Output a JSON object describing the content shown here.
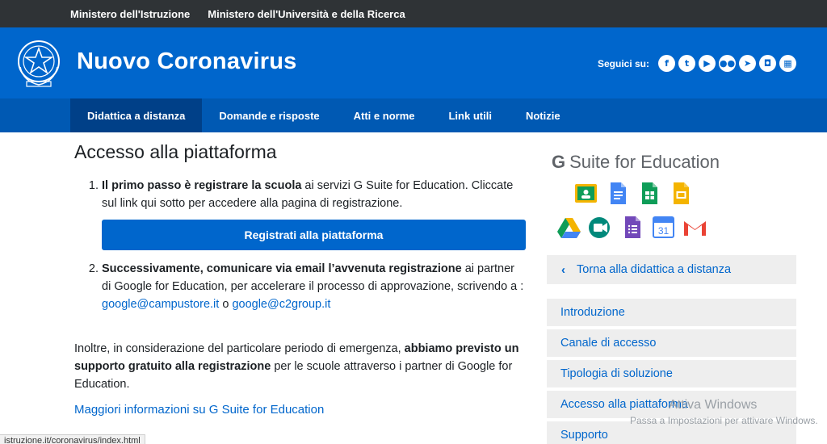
{
  "topbar": {
    "links": [
      "Ministero dell'Istruzione",
      "Ministero dell'Università e della Ricerca"
    ]
  },
  "header": {
    "title": "Nuovo Coronavirus",
    "social_label": "Seguici su:",
    "social_icons": [
      "facebook-icon",
      "twitter-icon",
      "youtube-icon",
      "flickr-icon",
      "telegram-icon",
      "instagram-icon",
      "feed-icon"
    ]
  },
  "nav": {
    "items": [
      "Didattica a distanza",
      "Domande e risposte",
      "Atti e norme",
      "Link utili",
      "Notizie"
    ],
    "active": "Didattica a distanza"
  },
  "main": {
    "title": "Accesso alla piattaforma",
    "step1_bold": "Il primo passo è registrare la scuola",
    "step1_rest": " ai servizi G Suite for Education. Cliccate sul link qui sotto per accedere alla pagina di registrazione.",
    "register_button": "Registrati alla piattaforma",
    "step2_bold": "Successivamente, comunicare via email l’avvenuta registrazione",
    "step2_rest": " ai partner di Google for Education, per accelerare il processo di approvazione, scrivendo a :",
    "email1": "google@campustore.it",
    "email_sep": " o ",
    "email2": "google@c2group.it",
    "para_start": "Inoltre, in considerazione del particolare periodo di emergenza, ",
    "para_bold": "abbiamo previsto un supporto gratuito alla registrazione",
    "para_end": " per le scuole attraverso i partner di Google for Education.",
    "more_link": "Maggiori informazioni su G Suite for Education"
  },
  "gsuite": {
    "title_g": "G",
    "title_rest": "Suite for Education",
    "calendar_day": "31"
  },
  "sidebar": {
    "back": "Torna alla didattica a distanza",
    "items": [
      "Introduzione",
      "Canale di accesso",
      "Tipologia di soluzione",
      "Accesso alla piattaforma",
      "Supporto"
    ]
  },
  "overlay": {
    "activate_title": "Attiva Windows",
    "activate_text": "Passa a Impostazioni per attivare Windows.",
    "status_url": "istruzione.it/coronavirus/index.html"
  },
  "colors": {
    "brand_blue": "#0066cc",
    "nav_blue": "#0059b3",
    "nav_active": "#004088",
    "topbar": "#2f3336"
  }
}
